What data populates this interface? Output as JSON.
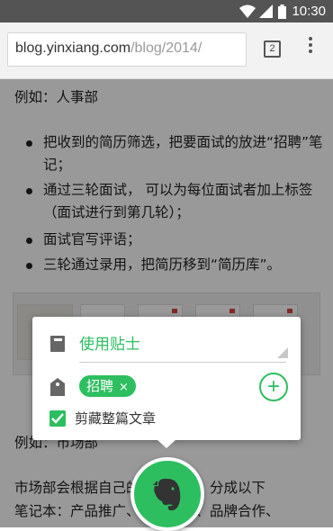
{
  "status_bar": {
    "time": "10:30"
  },
  "browser": {
    "url_domain": "blog.yinxiang.com",
    "url_path": "/blog/2014/",
    "tab_count": "2"
  },
  "article": {
    "p1": "例如：人事部",
    "bullets": [
      "把收到的简历筛选，把要面试的放进“招聘”笔记；",
      "通过三轮面试， 可以为每位面试者加上标签（面试进行到第几轮）；",
      "面试官写评语；",
      "三轮通过录用，把简历移到“简历库”。"
    ],
    "p2": "例如：市场部",
    "p3": "市场部会根据自己的工作情况，分成以下",
    "p4": "笔记本：产品推广、市场活动、品牌合作、"
  },
  "clipper": {
    "notebook": "使用贴士",
    "tag": "招聘",
    "tag_remove": "×",
    "add_tag": "+",
    "clip_option": "剪藏整篇文章",
    "accent_color": "#2dbe60",
    "fab_icon": "evernote-elephant-icon"
  }
}
